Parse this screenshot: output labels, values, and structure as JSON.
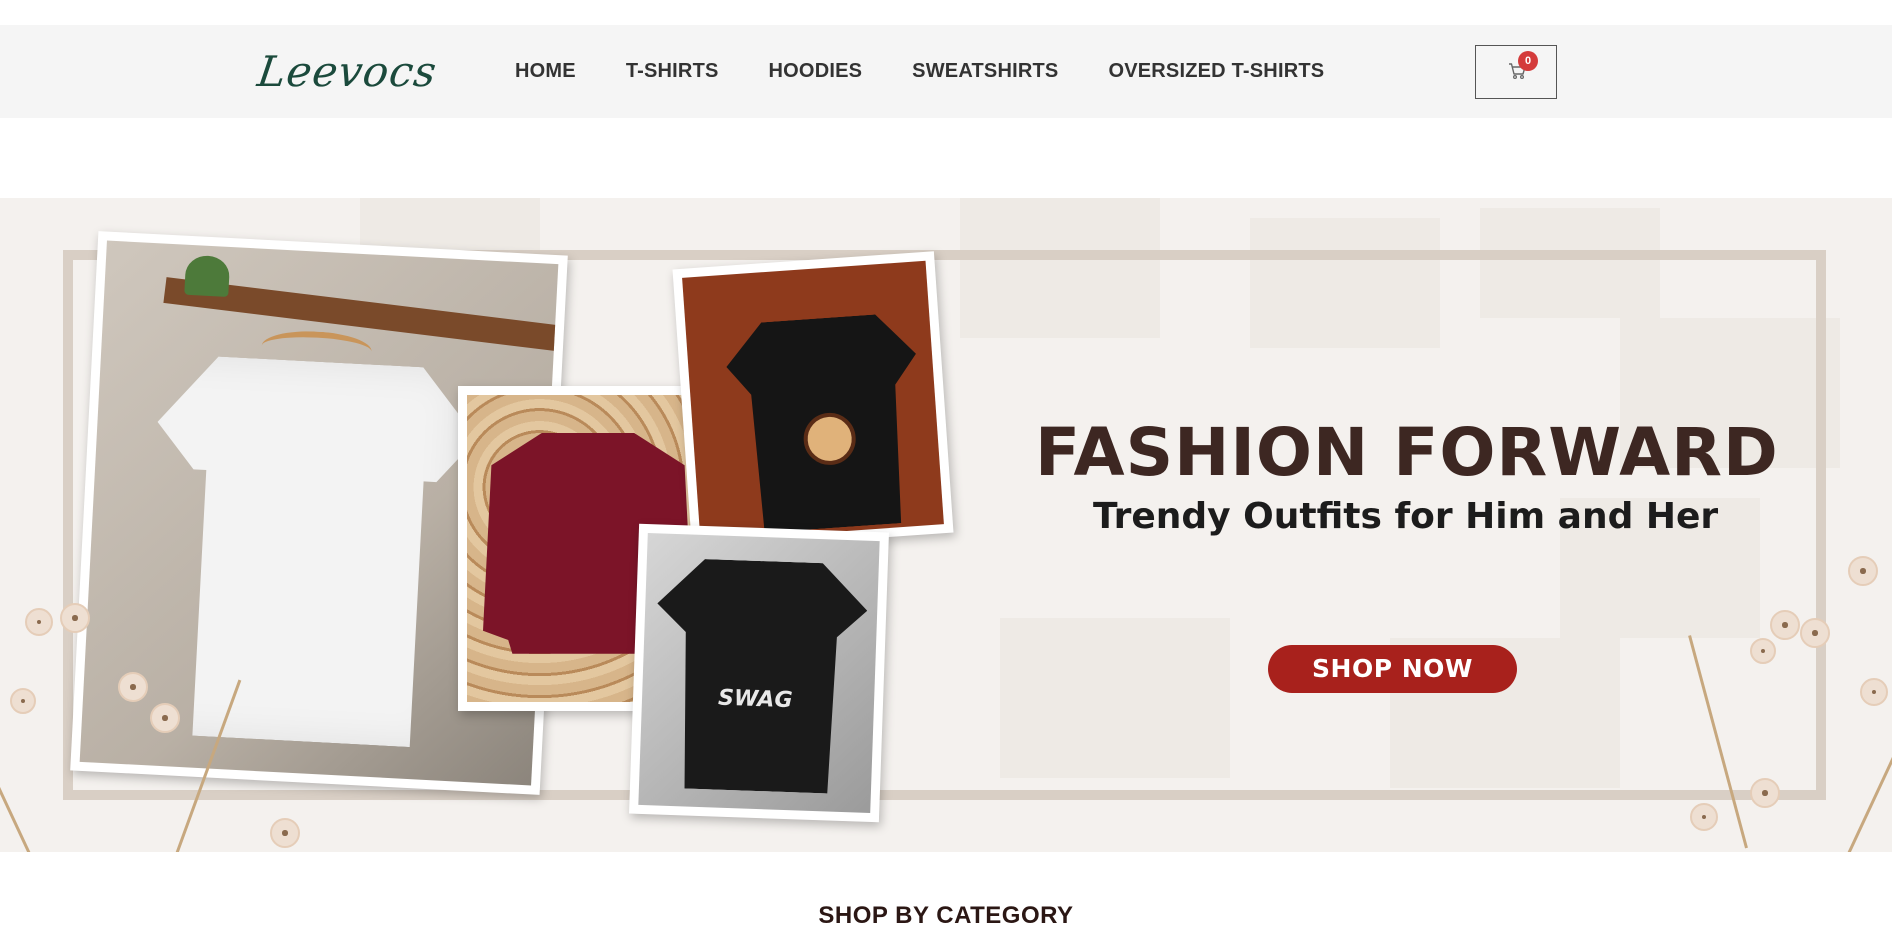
{
  "header": {
    "logo": "Leevocs",
    "nav": [
      "HOME",
      "T-SHIRTS",
      "HOODIES",
      "SWEATSHIRTS",
      "OVERSIZED T-SHIRTS"
    ],
    "cart": {
      "icon": "cart-icon",
      "count": "0"
    }
  },
  "hero": {
    "headline": "FASHION FORWARD",
    "subline": "Trendy Outfits for Him and Her",
    "cta": "SHOP NOW",
    "tee_print": "SWAG"
  },
  "section": {
    "title": "SHOP BY CATEGORY"
  },
  "colors": {
    "header_bg": "#f5f5f5",
    "logo": "#1b4a3c",
    "headline": "#3d2722",
    "cta_bg": "#a8211c",
    "badge": "#d43b3b"
  }
}
